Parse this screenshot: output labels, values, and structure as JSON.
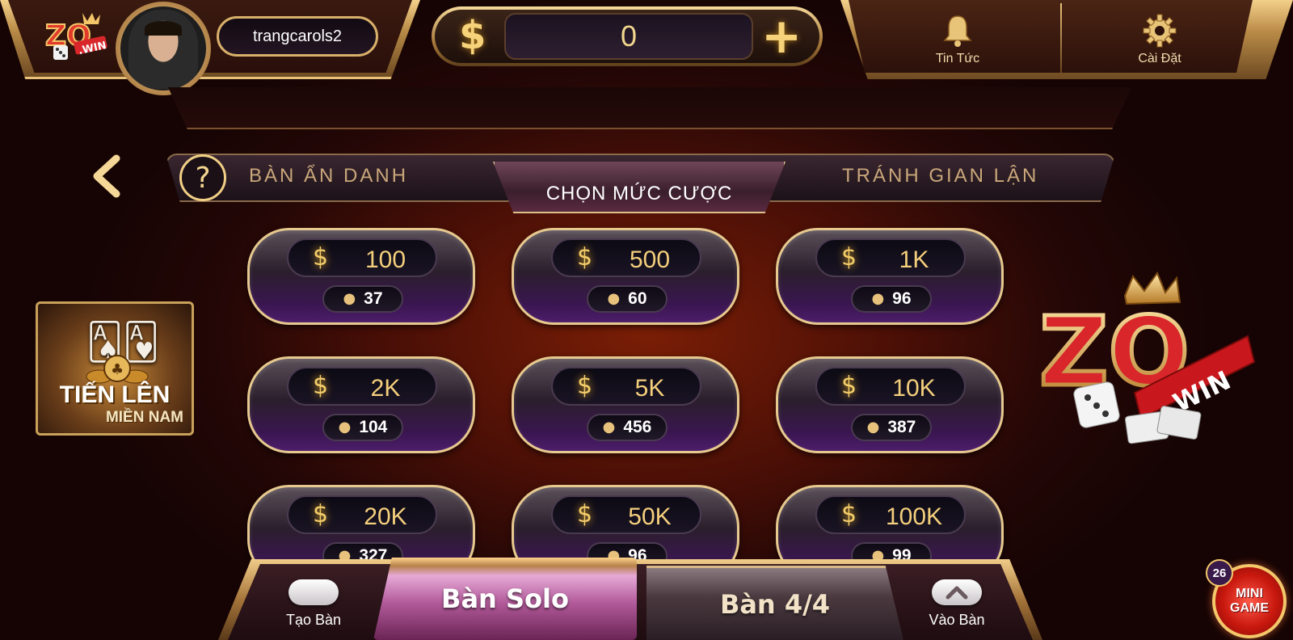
{
  "header": {
    "username": "trangcarols2",
    "balance": "0",
    "currency_symbol": "$",
    "add_symbol": "+",
    "news_label": "Tin Tức",
    "settings_label": "Cài Đặt"
  },
  "tabs": {
    "back_symbol": "‹",
    "help_symbol": "?",
    "left": "BÀN ẨN DANH",
    "active": "CHỌN MỨC CƯỢC",
    "right": "TRÁNH GIAN LẬN"
  },
  "game_thumb": {
    "title": "TIẾN LÊN",
    "subtitle": "MIỀN NAM"
  },
  "bets": [
    {
      "amount": "100",
      "players": "37"
    },
    {
      "amount": "500",
      "players": "60"
    },
    {
      "amount": "1K",
      "players": "96"
    },
    {
      "amount": "2K",
      "players": "104"
    },
    {
      "amount": "5K",
      "players": "456"
    },
    {
      "amount": "10K",
      "players": "387"
    },
    {
      "amount": "20K",
      "players": "327"
    },
    {
      "amount": "50K",
      "players": "96"
    },
    {
      "amount": "100K",
      "players": "99"
    }
  ],
  "bottom": {
    "create_table": "Tạo Bàn",
    "solo": "Bàn Solo",
    "four": "Bàn 4/4",
    "join_table": "Vào Bàn"
  },
  "minigame": {
    "badge": "26",
    "line1": "MINI",
    "line2": "GAME"
  },
  "logo": {
    "text_zo": "ZO",
    "text_win": ".WIN"
  },
  "colors": {
    "gold": "#e8c27a",
    "accent_purple": "#4c1d6a",
    "background_red": "#7a1e06"
  }
}
